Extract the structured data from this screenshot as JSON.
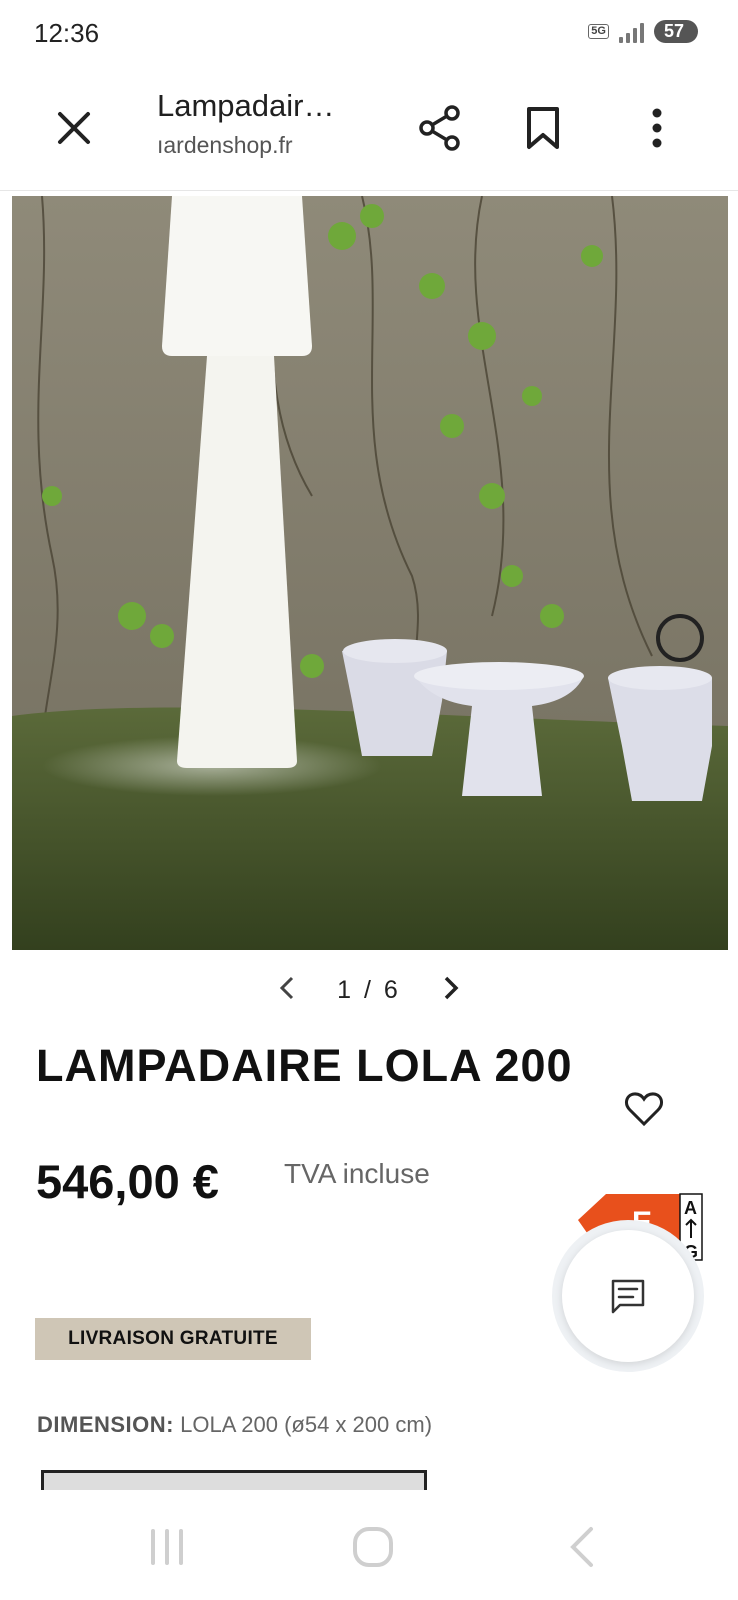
{
  "status_bar": {
    "time": "12:36",
    "network": "5G",
    "battery": "57"
  },
  "toolbar": {
    "title": "Lampadair…",
    "url": "ıardenshop.fr"
  },
  "carousel": {
    "current": 1,
    "total": 6,
    "counter_text": "1 / 6",
    "prev_icon": "chevron-left-icon",
    "next_icon": "chevron-right-icon"
  },
  "product": {
    "title": "LAMPADAIRE LOLA 200",
    "price": "546,00 €",
    "tax_note": "TVA incluse",
    "shipping_badge": "LIVRAISON GRATUITE",
    "dimension_label": "DIMENSION:",
    "dimension_value": "LOLA 200 (ø54 x 200 cm)"
  },
  "energy_label": {
    "class": "E",
    "scale_top": "A",
    "scale_bottom": "G"
  },
  "colors": {
    "energy_orange": "#e8501c",
    "badge_bg": "#cfc6b6",
    "text_dark": "#111111",
    "text_muted": "#666666"
  },
  "icons": [
    "close-icon",
    "share-icon",
    "bookmark-icon",
    "more-vert-icon",
    "heart-icon",
    "chat-icon",
    "recent-apps-icon",
    "home-icon",
    "back-icon"
  ]
}
